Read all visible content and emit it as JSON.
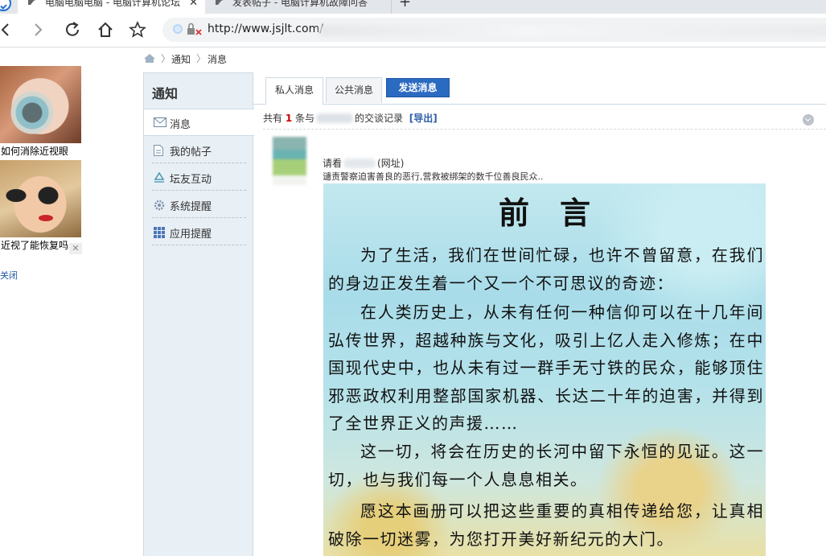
{
  "browser": {
    "tabs": [
      {
        "title": "电脑电脑电脑 - 电脑计算机论坛",
        "close": "✕"
      },
      {
        "title": "发表帖子 - 电脑计算机故障问答"
      }
    ],
    "new_tab": "+",
    "url": "http://www.jsjlt.com/"
  },
  "ads": {
    "items": [
      {
        "caption": "如何消除近视眼"
      },
      {
        "caption": "近视了能恢复吗"
      }
    ],
    "close_x": "✕",
    "close_link": "关闭"
  },
  "breadcrumb": {
    "items": [
      "通知",
      "消息"
    ],
    "separator": "〉"
  },
  "sidebar": {
    "title": "通知",
    "items": [
      {
        "label": "消息",
        "icon": "envelope-icon"
      },
      {
        "label": "我的帖子",
        "icon": "document-icon"
      },
      {
        "label": "坛友互动",
        "icon": "recycle-icon"
      },
      {
        "label": "系统提醒",
        "icon": "gear-icon"
      },
      {
        "label": "应用提醒",
        "icon": "grid-icon"
      }
    ]
  },
  "main": {
    "tabs": [
      {
        "label": "私人消息",
        "active": true
      },
      {
        "label": "公共消息",
        "active": false
      }
    ],
    "send_button": "发送消息",
    "summary": {
      "prefix": "共有",
      "count": "1",
      "middle": "条与",
      "suffix": "的交谈记录",
      "export": "[导出]"
    },
    "message": {
      "from_prefix": "请看",
      "from_suffix": "(网址)",
      "text": "谴责警察迫害善良的恶行,营救被绑架的数千位善良民众..",
      "image": {
        "title": "前言",
        "paragraphs": [
          "为了生活，我们在世间忙碌，也许不曾留意，在我们的身边正发生着一个又一个不可思议的奇迹：",
          "在人类历史上，从未有任何一种信仰可以在十几年间弘传世界，超越种族与文化，吸引上亿人走入修炼；在中国现代史中，也从未有过一群手无寸铁的民众，能够顶住邪恶政权利用整部国家机器、长达二十年的迫害，并得到了全世界正义的声援……",
          "这一切，将会在历史的长河中留下永恒的见证。这一切，也与我们每一个人息息相关。",
          "愿这本画册可以把这些重要的真相传递给您，让真相破除一切迷雾，为您打开美好新纪元的大门。"
        ]
      }
    }
  },
  "colors": {
    "accent": "#2b6ac1",
    "count": "#cc0000",
    "sidebar_bg": "#e8eff5"
  }
}
